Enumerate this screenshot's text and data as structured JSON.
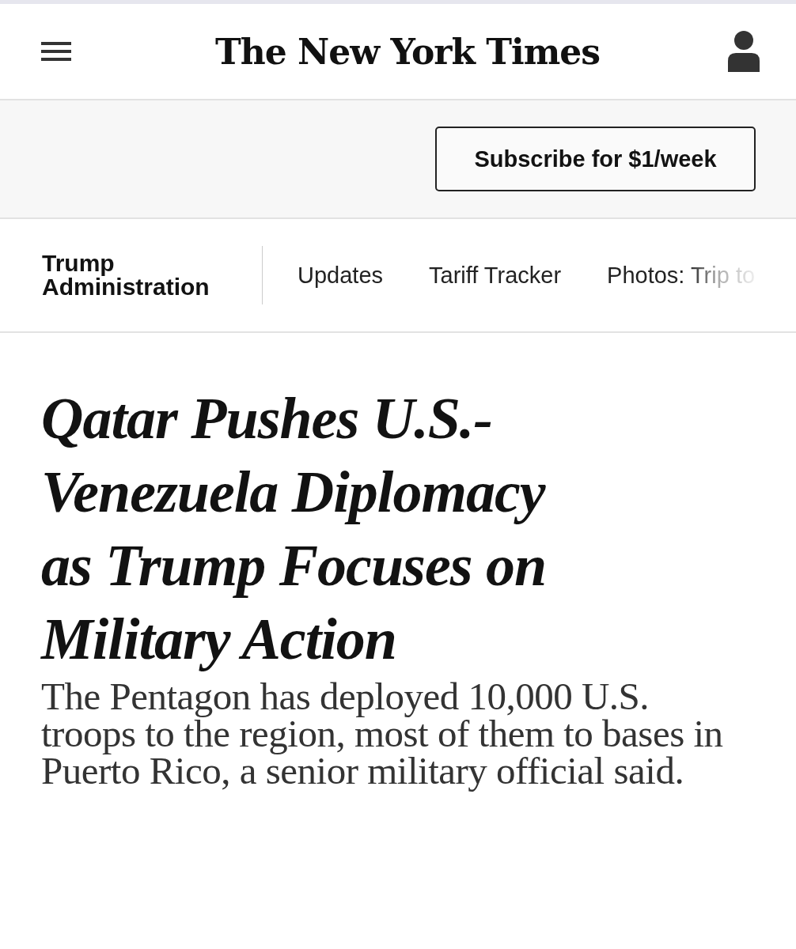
{
  "masthead": {
    "logo": "The New York Times"
  },
  "promo": {
    "button": "Subscribe for $1/week"
  },
  "section_nav": {
    "title": "Trump Administration",
    "links": [
      {
        "label": "Updates",
        "clipped": false
      },
      {
        "label": "Tariff Tracker",
        "clipped": false
      },
      {
        "label": "Photos: Trip to",
        "clipped": true
      }
    ]
  },
  "article": {
    "headline": "Qatar Pushes U.S.-Venezuela Diplomacy as Trump Focuses on Military Action",
    "summary": "The Pentagon has deployed 10,000 U.S. troops to the region, most of them to bases in Puerto Rico, a senior military official said."
  }
}
